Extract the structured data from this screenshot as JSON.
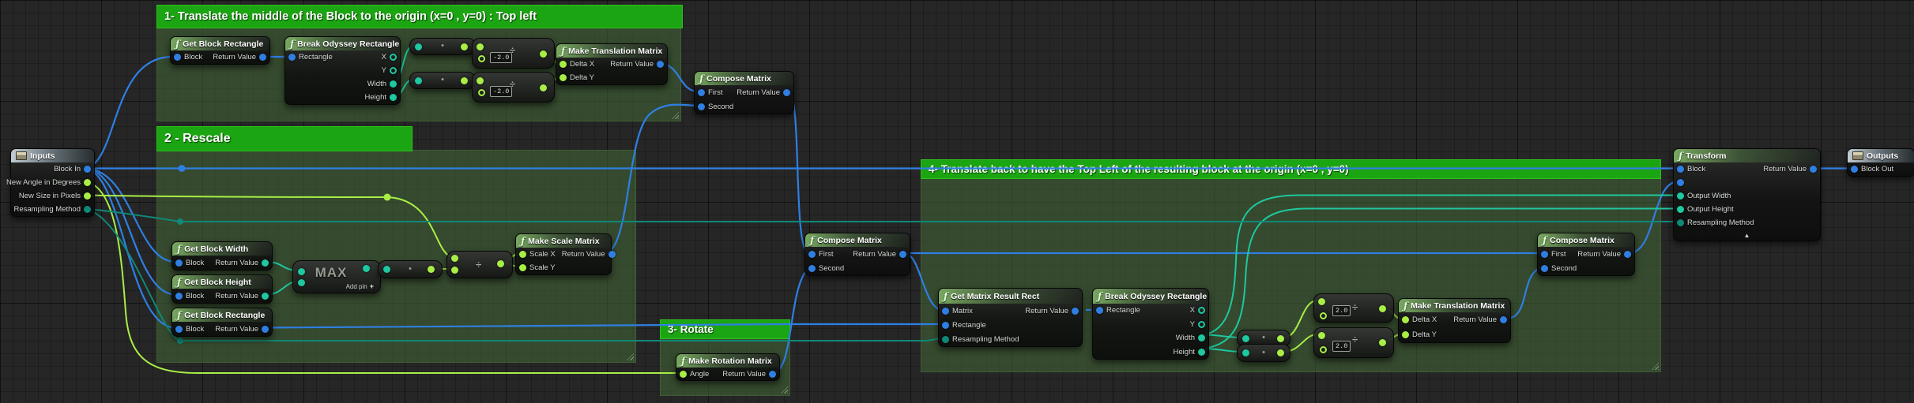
{
  "comments": {
    "c1": "1- Translate the middle of the Block to the origin (x=0 , y=0) : Top left",
    "c2": "2 - Rescale",
    "c3": "3- Rotate",
    "c4": "4- Translate back to have the Top Left of the resulting block at the origin (x=0 , y=0)"
  },
  "nodes": {
    "inputs": "Inputs",
    "outputs": "Outputs",
    "get_block_rectangle": "Get Block Rectangle",
    "break_odyssey_rectangle": "Break Odyssey Rectangle",
    "make_translation_matrix": "Make Translation Matrix",
    "compose_matrix": "Compose Matrix",
    "get_block_width": "Get Block Width",
    "get_block_height": "Get Block Height",
    "make_scale_matrix": "Make Scale Matrix",
    "make_rotation_matrix": "Make Rotation Matrix",
    "get_matrix_result_rect": "Get Matrix Result Rect",
    "transform": "Transform",
    "max": "MAX"
  },
  "labels": {
    "block": "Block",
    "return_value": "Return Value",
    "rectangle": "Rectangle",
    "x": "X",
    "y": "Y",
    "width": "Width",
    "height": "Height",
    "delta_x": "Delta X",
    "delta_y": "Delta Y",
    "first": "First",
    "second": "Second",
    "scale_x": "Scale X",
    "scale_y": "Scale Y",
    "angle": "Angle",
    "matrix": "Matrix",
    "resampling_method": "Resampling Method",
    "output_width": "Output Width",
    "output_height": "Output Height",
    "block_in": "Block In",
    "block_out": "Block Out",
    "new_angle_in_degrees": "New Angle in Degrees",
    "new_size_in_pixels": "New Size in Pixels"
  },
  "values": {
    "divide1": "-2.0",
    "divide2": "-2.0",
    "divide3": "2.0",
    "divide4": "2.0"
  },
  "misc": {
    "add_pin": "Add pin"
  },
  "icons": {
    "fn": "ƒ",
    "divide": "÷",
    "dot": "•",
    "collapse": "▲",
    "add": "+"
  },
  "colors": {
    "exec_blue": "#2f7fe3",
    "teal": "#1ec8a0",
    "lime": "#a8ee46",
    "dark_teal": "#0f8878",
    "comment_green": "#1ca512"
  }
}
